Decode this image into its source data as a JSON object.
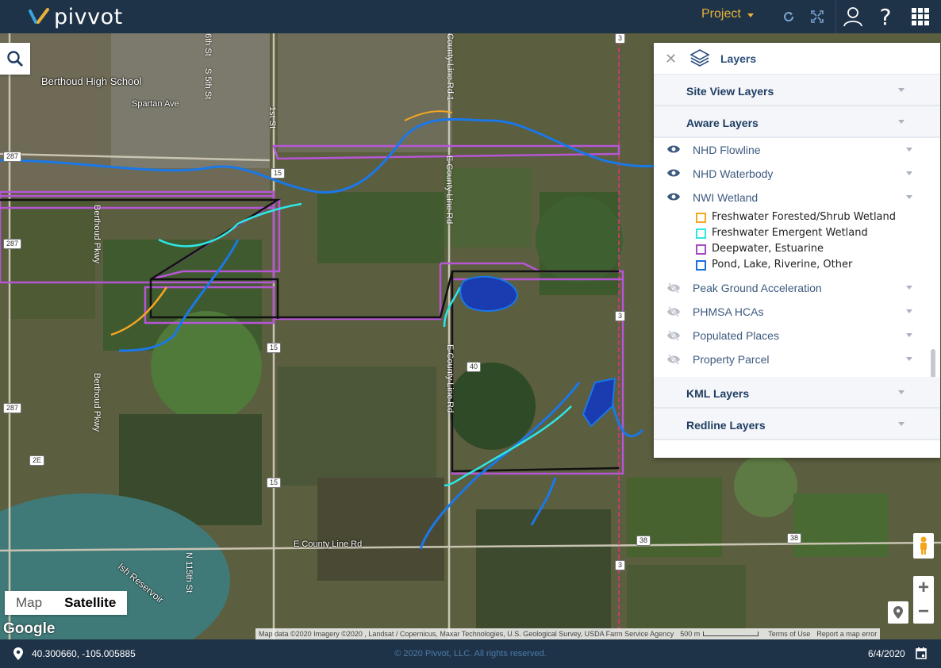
{
  "app": {
    "brand": "pivvot",
    "project_label": "Project"
  },
  "toolbar": {
    "icons": [
      "refresh-icon",
      "fullscreen-icon",
      "user-icon",
      "help-icon",
      "apps-grid-icon"
    ]
  },
  "map": {
    "labels": {
      "school": "Berthoud High School",
      "spartan_ave": "Spartan Ave",
      "e_county_line_rd_h": "E County Line Rd",
      "county_line_rd_1": "County Line Rd 1",
      "e_county_line_rd_v": "E County Line Rd",
      "e_county_line_rd_v2": "E County Line Rd",
      "berthoud_pkwy_1": "Berthoud Pkwy",
      "berthoud_pkwy_2": "Berthoud Pkwy",
      "st_1st": "1st St",
      "st_5th": "S 5th St",
      "st_6th": "6th St",
      "n_115th": "N 115th St",
      "reservoir": "Ish Reservoir"
    },
    "shields": [
      "287",
      "287",
      "287",
      "15",
      "15",
      "15",
      "40",
      "2E",
      "38",
      "38",
      "3",
      "3",
      "3"
    ],
    "maptype": {
      "map": "Map",
      "satellite": "Satellite",
      "active": "Satellite"
    },
    "google": "Google",
    "attribution": "Map data ©2020 Imagery ©2020 , Landsat / Copernicus, Maxar Technologies, U.S. Geological Survey, USDA Farm Service Agency",
    "scale": "500 m",
    "terms": "Terms of Use",
    "report": "Report a map error"
  },
  "layers_panel": {
    "title": "Layers",
    "sections": {
      "site_view": "Site View Layers",
      "aware": "Aware Layers",
      "kml": "KML Layers",
      "redline": "Redline Layers"
    },
    "aware_layers": [
      {
        "label": "NHD Flowline",
        "visible": true
      },
      {
        "label": "NHD Waterbody",
        "visible": true
      },
      {
        "label": "NWI Wetland",
        "visible": true
      },
      {
        "label": "Peak Ground Acceleration",
        "visible": false
      },
      {
        "label": "PHMSA HCAs",
        "visible": false
      },
      {
        "label": "Populated Places",
        "visible": false
      },
      {
        "label": "Property Parcel",
        "visible": false
      }
    ],
    "wetland_legend": [
      {
        "label": "Freshwater Forested/Shrub Wetland",
        "color": "#f5a623"
      },
      {
        "label": "Freshwater Emergent Wetland",
        "color": "#2ee6e6"
      },
      {
        "label": "Deepwater, Estuarine",
        "color": "#a44cc2"
      },
      {
        "label": "Pond, Lake, Riverine, Other",
        "color": "#1a6fe0"
      }
    ]
  },
  "footer": {
    "coordinates": "40.300660, -105.005885",
    "copyright": "© 2020 Pivvot, LLC. All rights reserved.",
    "date": "6/4/2020"
  }
}
